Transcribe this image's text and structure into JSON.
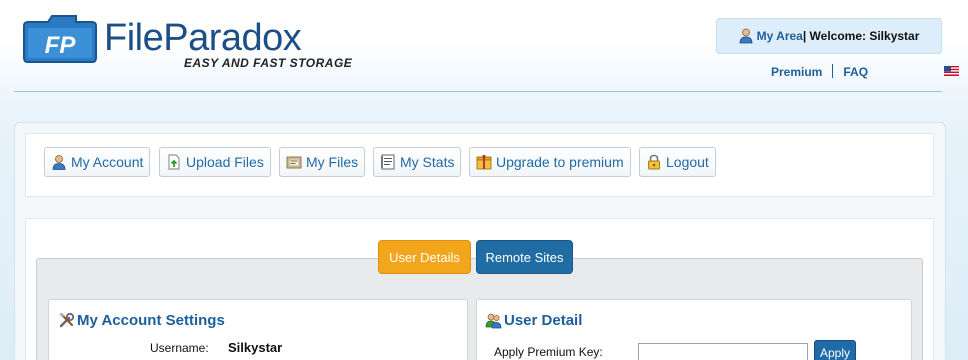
{
  "brand": {
    "name": "FileParadox",
    "tagline": "EASY AND FAST STORAGE",
    "badge_text": "FP",
    "primary_color": "#1d4f86",
    "accent_color": "#1d5f9a"
  },
  "header": {
    "my_area_label": "My Area",
    "welcome_text": "| Welcome: Silkystar",
    "links": {
      "premium": "Premium",
      "faq": "FAQ"
    },
    "flag_icon": "us-flag-icon"
  },
  "nav": {
    "items": [
      {
        "label": "My Account",
        "icon": "user-icon"
      },
      {
        "label": "Upload Files",
        "icon": "upload-icon"
      },
      {
        "label": "My Files",
        "icon": "files-icon"
      },
      {
        "label": "My Stats",
        "icon": "stats-icon"
      },
      {
        "label": "Upgrade to premium",
        "icon": "premium-icon"
      },
      {
        "label": "Logout",
        "icon": "lock-icon"
      }
    ]
  },
  "tabs": {
    "user_details": "User Details",
    "remote_sites": "Remote Sites",
    "active_color": "#f3a51b",
    "inactive_color": "#206da3"
  },
  "account_settings": {
    "title": "My Account Settings",
    "icon": "tools-icon",
    "username_label": "Username:",
    "username_value": "Silkystar"
  },
  "user_detail": {
    "title": "User Detail",
    "icon": "users-icon",
    "premium_key_label": "Apply Premium Key:",
    "premium_key_value": "",
    "apply_label": "Apply"
  }
}
